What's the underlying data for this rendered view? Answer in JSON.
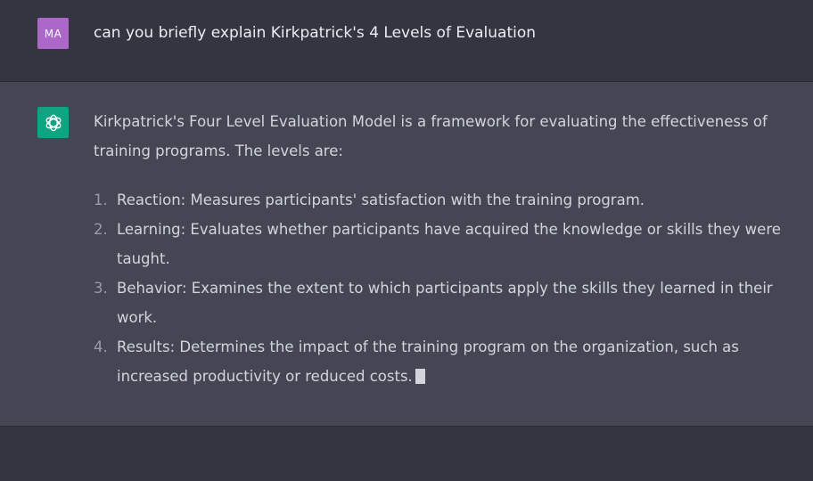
{
  "user_message": {
    "avatar_initials": "MA",
    "avatar_color": "#ab68c9",
    "text": "can you briefly explain Kirkpatrick's 4 Levels of Evaluation"
  },
  "assistant_message": {
    "avatar_icon": "openai-logo-icon",
    "avatar_color": "#10a37f",
    "intro": "Kirkpatrick's Four Level Evaluation Model is a framework for evaluating the effectiveness of training programs. The levels are:",
    "items": [
      {
        "number": "1.",
        "text": "Reaction: Measures participants' satisfaction with the training program."
      },
      {
        "number": "2.",
        "text": "Learning: Evaluates whether participants have acquired the knowledge or skills they were taught."
      },
      {
        "number": "3.",
        "text": "Behavior: Examines the extent to which participants apply the skills they learned in their work."
      },
      {
        "number": "4.",
        "text": "Results: Determines the impact of the training program on the organization, such as increased productivity or reduced costs."
      }
    ]
  },
  "colors": {
    "background": "#343541",
    "assistant_background": "#444654",
    "text": "#d1d5db"
  }
}
